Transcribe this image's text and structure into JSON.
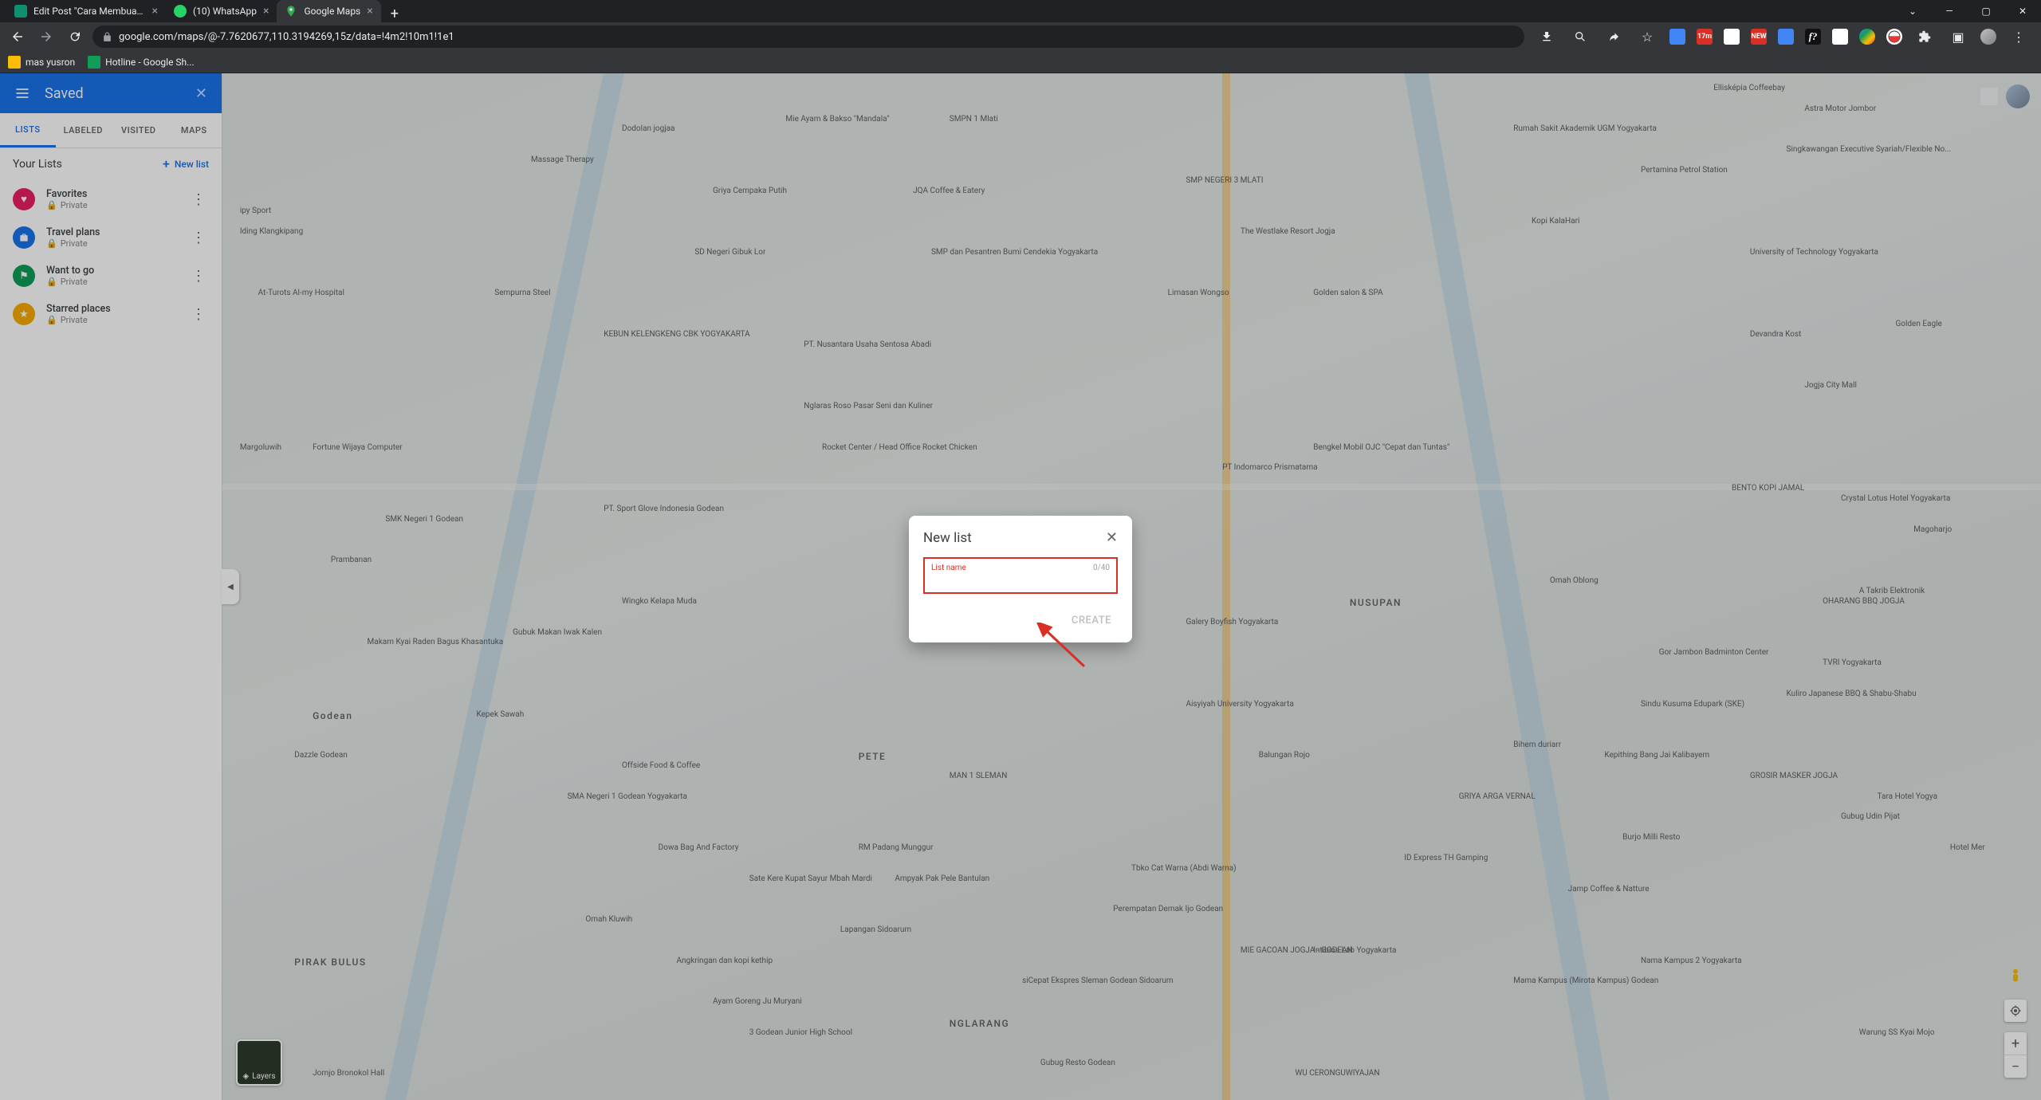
{
  "browser": {
    "tabs": [
      {
        "title": "Edit Post \"Cara Membuat Alamat",
        "active": false
      },
      {
        "title": "(10) WhatsApp",
        "active": false
      },
      {
        "title": "Google Maps",
        "active": true
      }
    ],
    "url_display": "google.com/maps/@-7.7620677,110.3194269,15z/data=!4m2!10m1!1e1",
    "bookmarks": [
      {
        "label": "mas yusron"
      },
      {
        "label": "Hotline - Google Sh..."
      }
    ],
    "ext_badge_17m": "17m",
    "ext_badge_new": "NEW"
  },
  "sidebar": {
    "title": "Saved",
    "tabs": [
      {
        "label": "LISTS",
        "active": true
      },
      {
        "label": "LABELED",
        "active": false
      },
      {
        "label": "VISITED",
        "active": false
      },
      {
        "label": "MAPS",
        "active": false
      }
    ],
    "section_title": "Your Lists",
    "new_list_label": "New list",
    "items": [
      {
        "name": "Favorites",
        "visibility": "Private",
        "icon_color": "#e91e63",
        "icon": "heart"
      },
      {
        "name": "Travel plans",
        "visibility": "Private",
        "icon_color": "#1a73e8",
        "icon": "briefcase"
      },
      {
        "name": "Want to go",
        "visibility": "Private",
        "icon_color": "#0f9d58",
        "icon": "flag"
      },
      {
        "name": "Starred places",
        "visibility": "Private",
        "icon_color": "#f9ab00",
        "icon": "star"
      }
    ]
  },
  "dialog": {
    "title": "New list",
    "input_label": "List name",
    "counter": "0/40",
    "input_value": "",
    "create_label": "CREATE"
  },
  "map": {
    "layers_label": "Layers",
    "area_labels": [
      "Godean",
      "PIRAK BULUS",
      "PETE",
      "NGLARANG",
      "NUSUPAN"
    ],
    "place_labels": [
      "Dodolan jogjaa",
      "Mie Ayam & Bakso \"Mandala\"",
      "SMPN 1 Mlati",
      "Griya Cempaka Putih",
      "JQA Coffee & Eatery",
      "SMP NEGERI 3 MLATI",
      "SD Negeri Gibuk Lor",
      "Sempurna Steel",
      "KEBUN KELENGKENG CBK YOGYAKARTA",
      "PT. Nusantara Usaha Sentosa Abadi",
      "Nglaras Roso Pasar Seni dan Kuliner",
      "Rocket Center / Head Office Rocket Chicken",
      "PT. Sport Glove Indonesia Godean",
      "SMK Negeri 1 Godean",
      "Wingko Kelapa Muda",
      "Makam Kyai Raden Bagus Khasantuka",
      "Gubuk Makan Iwak Kalen",
      "Kepek Sawah",
      "Dazzle Godean",
      "Offside Food & Coffee",
      "SMA Negeri 1 Godean Yogyakarta",
      "Dowa Bag And Factory",
      "RM Padang Munggur",
      "Ayam Goreng Ju Muryani",
      "Lapangan Sidoarum",
      "Angkringan dan kopi kethip",
      "MAN 1 SLEMAN",
      "Rumah Sakit Akademik UGM Yogyakarta",
      "The Westlake Resort Jogja",
      "Kopi KalaHari",
      "Pertamina Petrol Station",
      "University of Technology Yogyakarta",
      "Golden salon & SPA",
      "Limasan Wongso",
      "Jogja City Mall",
      "Devandra Kost",
      "BENTO KOPI JAMAL",
      "Crystal Lotus Hotel Yogyakarta",
      "A Takrib Elektronik",
      "Omah Oblong",
      "OHARANG BBQ JOGJA",
      "Gor Jambon Badminton Center",
      "TVRI Yogyakarta",
      "Kuliro Japanese BBQ & Shabu-Shabu",
      "Sindu Kusuma Edupark (SKE)",
      "GROSIR MASKER JOGJA",
      "Tara Hotel Yogya",
      "Hotel Mer",
      "Bengkel Mobil OJC \"Cepat dan Tuntas\"",
      "Galery Boyfish Yogyakarta",
      "PT Indomarco Prismatama",
      "Warung SS Kyai Mojo",
      "Mama Kampus (Mirota Kampus) Godean",
      "siCepat Ekspres Sleman Godean Sidoarum",
      "3 Godean Junior High School",
      "Sate Kere Kupat Sayur Mbah Mardi",
      "Ampyak Pak Pele Bantulan",
      "Tbko Cat Warna (Abdi Warna)",
      "Omah Kluwih",
      "Intibios Lab Yogyakarta",
      "Aisyiyah University Yogyakarta",
      "Perempatan Demak Ijo Godean",
      "GRIYA ARGA VERNAL",
      "Kepithing Bang Jai Kalibayem",
      "Burjo Milli Resto",
      "ID Express TH Gamping",
      "MIE GACOAN JOGJA - GODEAN",
      "At-Turots Al-my Hospital",
      "SMP dan Pesantren Bumi Cendekia Yogyakarta",
      "Ellisképia Coffeebay",
      "Astra Motor Jombor",
      "Singkawangan Executive Syariah/Flexible No...",
      "Golden Eagle",
      "Fortune Wijaya Computer",
      "Margoluwih",
      "Iding Klangkipang",
      "ipy Sport",
      "Jomjo Bronokol Hall",
      "Nama Kampus 2 Yogyakarta",
      "Magoharjo",
      "Massage Therapy",
      "Prambanan",
      "Gubug Resto Godean",
      "WU CERONGUWIYAJAN",
      "Bihem duriarr",
      "Jamp Coffee & Natture",
      "Gubug Udin Pijat",
      "Balungan Rojo"
    ]
  }
}
